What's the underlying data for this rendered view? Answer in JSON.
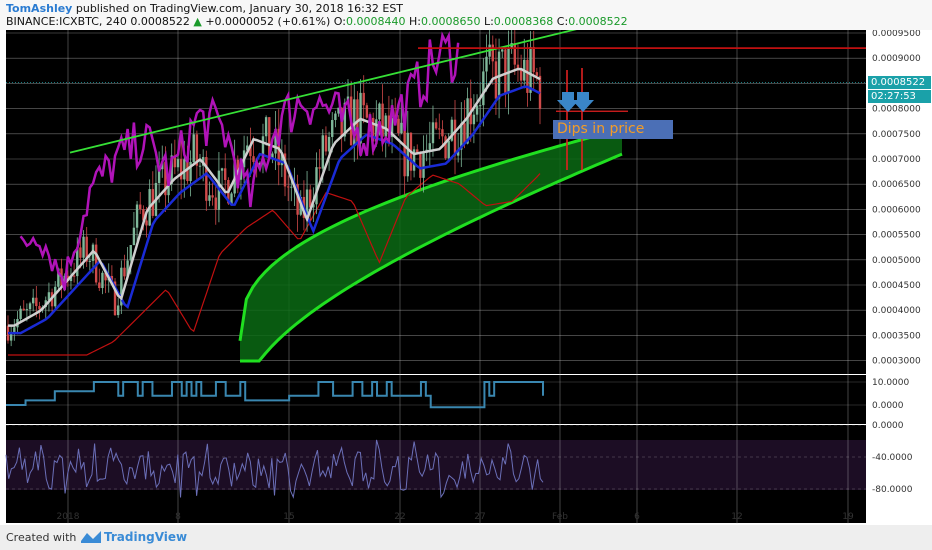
{
  "header": {
    "author": "TomAshley",
    "published": "published on TradingView.com, January 30, 2018 16:32 EST",
    "symbol": "BINANCE:ICXBTC, 240",
    "last": "0.0008522",
    "change": "+0.0000052 (+0.61%)",
    "open_label": "O:",
    "open": "0.0008440",
    "high_label": "H:",
    "high": "0.0008650",
    "low_label": "L:",
    "low": "0.0008368",
    "close_label": "C:",
    "close": "0.0008522"
  },
  "price_tag": "0.0008522",
  "countdown": "02:27:53",
  "annotation": "Dips in price",
  "footer": {
    "created_with": "Created with",
    "brand": "TradingView"
  },
  "colors": {
    "background": "#000000",
    "grid": "#cccccc",
    "candle_up": "#7fb89a",
    "candle_down": "#d04a4a",
    "tenkan": "#1a2bd6",
    "kijun": "#cfcfcf",
    "cloud_fill": "#0b6a14",
    "cloud_edge": "#20e020",
    "chikou": "#b013b8",
    "trendline": "#36e036",
    "resistance": "#c01010",
    "panel1": "#3a87b0",
    "panel2": "#6b6fb8",
    "price_tag": "#1aa1a9",
    "annotation_box": "#4b6fb6",
    "annotation_text": "#f39c27",
    "arrow": "#3a86c8"
  },
  "chart_data": {
    "type": "candlestick",
    "x_tick_labels": [
      "2018",
      "8",
      "15",
      "22",
      "27",
      "Feb",
      "6",
      "12",
      "19"
    ],
    "price_axis": {
      "ticks": [
        "0.0009500",
        "0.0009000",
        "0.0008500",
        "0.0008000",
        "0.0007500",
        "0.0007000",
        "0.0006500",
        "0.0006000",
        "0.0005500",
        "0.0005000",
        "0.0004500",
        "0.0004000",
        "0.0003500",
        "0.0003000"
      ],
      "range": [
        0.00027,
        0.00096
      ]
    },
    "panel1_axis": {
      "ticks": [
        "10.0000",
        "0.0000"
      ],
      "range": [
        -8,
        13
      ]
    },
    "panel2_axis": {
      "ticks": [
        "0.0000",
        "-40.0000",
        "-80.0000"
      ],
      "range": [
        -100,
        0
      ]
    },
    "series": [
      {
        "name": "price",
        "values_approx": [
          0.00037,
          0.0004,
          0.00046,
          0.00052,
          0.00042,
          0.0006,
          0.00066,
          0.0007,
          0.00063,
          0.00074,
          0.00072,
          0.00058,
          0.00073,
          0.00078,
          0.00076,
          0.00071,
          0.00072,
          0.00078,
          0.00086,
          0.00088,
          0.000852
        ]
      }
    ]
  }
}
